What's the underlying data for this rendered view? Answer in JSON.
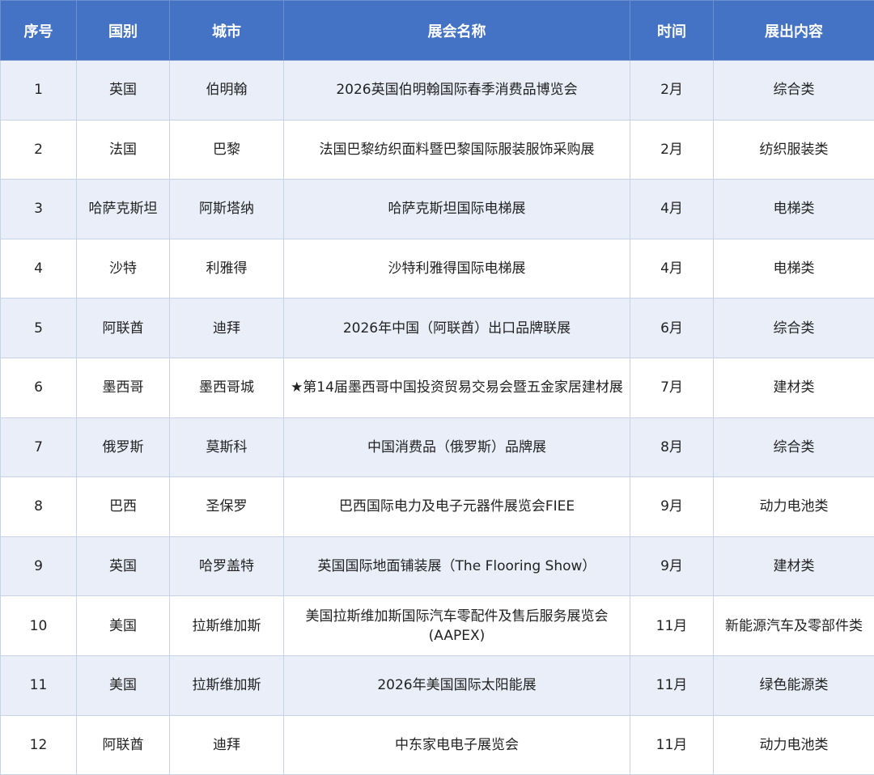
{
  "headers": [
    "序号",
    "国别",
    "城市",
    "展会名称",
    "时间",
    "展出内容"
  ],
  "rows": [
    [
      "1",
      "英国",
      "伯明翰",
      "2026英国伯明翰国际春季消费品博览会",
      "2月",
      "综合类"
    ],
    [
      "2",
      "法国",
      "巴黎",
      "法国巴黎纺织面料暨巴黎国际服装服饰采购展",
      "2月",
      "纺织服装类"
    ],
    [
      "3",
      "哈萨克斯坦",
      "阿斯塔纳",
      "哈萨克斯坦国际电梯展",
      "4月",
      "电梯类"
    ],
    [
      "4",
      "沙特",
      "利雅得",
      "沙特利雅得国际电梯展",
      "4月",
      "电梯类"
    ],
    [
      "5",
      "阿联酋",
      "迪拜",
      "2026年中国（阿联酋）出口品牌联展",
      "6月",
      "综合类"
    ],
    [
      "6",
      "墨西哥",
      "墨西哥城",
      "★第14届墨西哥中国投资贸易交易会暨五金家居建材展",
      "7月",
      "建材类"
    ],
    [
      "7",
      "俄罗斯",
      "莫斯科",
      "中国消费品（俄罗斯）品牌展",
      "8月",
      "综合类"
    ],
    [
      "8",
      "巴西",
      "圣保罗",
      "巴西国际电力及电子元器件展览会FIEE",
      "9月",
      "动力电池类"
    ],
    [
      "9",
      "英国",
      "哈罗盖特",
      "英国国际地面铺装展（The Flooring Show）",
      "9月",
      "建材类"
    ],
    [
      "10",
      "美国",
      "拉斯维加斯",
      "美国拉斯维加斯国际汽车零配件及售后服务展览会(AAPEX)",
      "11月",
      "新能源汽车及零部件类"
    ],
    [
      "11",
      "美国",
      "拉斯维加斯",
      "2026年美国国际太阳能展",
      "11月",
      "绿色能源类"
    ],
    [
      "12",
      "阿联酋",
      "迪拜",
      "中东家电电子展览会",
      "11月",
      "动力电池类"
    ]
  ]
}
